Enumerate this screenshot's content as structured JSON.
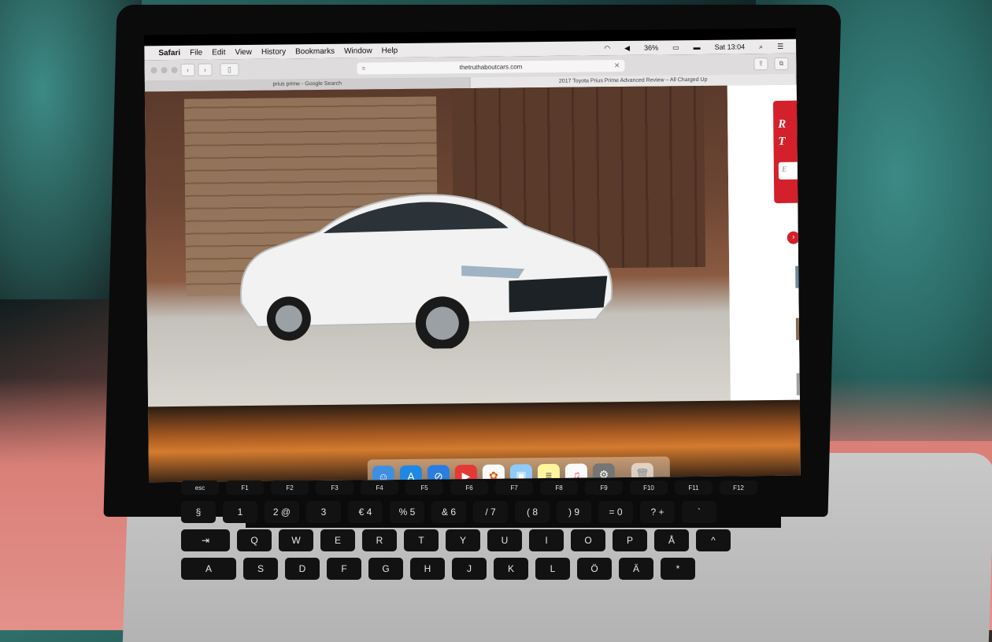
{
  "menubar": {
    "app": "Safari",
    "menus": [
      "File",
      "Edit",
      "View",
      "History",
      "Bookmarks",
      "Window",
      "Help"
    ],
    "battery": "36%",
    "clock": "Sat 13:04"
  },
  "toolbar": {
    "url": "thetruthaboutcars.com"
  },
  "tabs": [
    "prius prime - Google Search",
    "2017 Toyota Prius Prime Advanced Review – All Charged Up"
  ],
  "sidebar": {
    "promo_letters": [
      "R",
      "T"
    ],
    "input_letter": "E"
  },
  "dock_icons": [
    "finder-icon",
    "app-store-icon",
    "safari-icon",
    "youtube-icon",
    "photos-icon",
    "preview-icon",
    "notes-icon",
    "itunes-icon",
    "system-preferences-icon",
    "trash-icon"
  ],
  "keyboard": {
    "fn_row": [
      "esc",
      "F1",
      "F2",
      "F3",
      "F4",
      "F5",
      "F6",
      "F7",
      "F8",
      "F9",
      "F10",
      "F11",
      "F12"
    ],
    "number_row": [
      "§",
      "1",
      "2 @",
      "3",
      "€ 4",
      "% 5",
      "& 6",
      "/ 7",
      "( 8",
      ") 9",
      "= 0",
      "? +",
      "`"
    ],
    "top_row": [
      "⇥",
      "Q",
      "W",
      "E",
      "R",
      "T",
      "Y",
      "U",
      "I",
      "O",
      "P",
      "Å",
      "^"
    ],
    "home_row": [
      "A",
      "S",
      "D",
      "F",
      "G",
      "H",
      "J",
      "K",
      "L",
      "Ö",
      "Ä",
      "*"
    ]
  },
  "colors": {
    "accent_red": "#d3202b",
    "menubar": "#eceaea"
  }
}
